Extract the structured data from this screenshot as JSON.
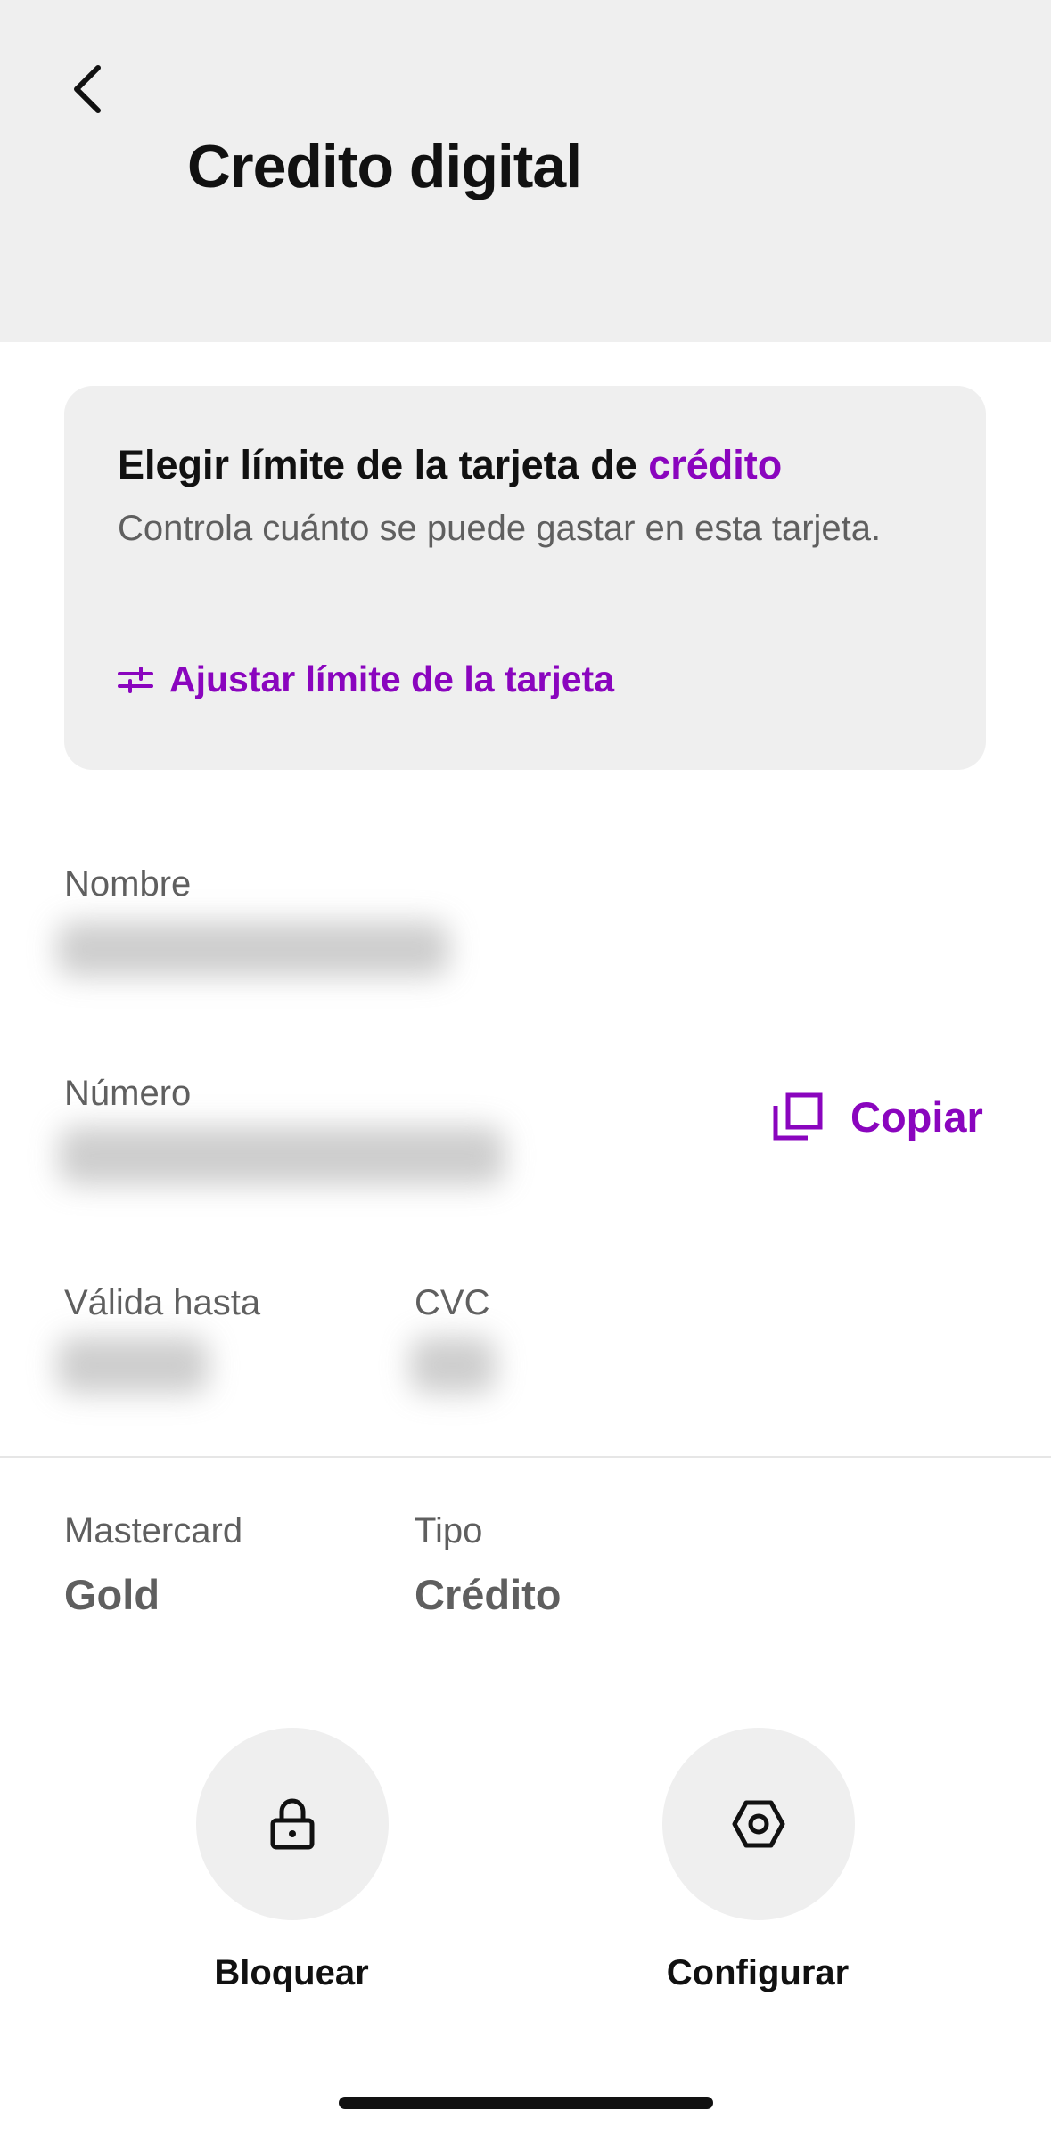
{
  "header": {
    "title": "Credito digital",
    "back_icon": "chevron-left-icon"
  },
  "limit_card": {
    "title_main": "Elegir límite de la tarjeta de ",
    "title_accent": "crédito",
    "description": "Controla cuánto se puede gastar en esta tarjeta.",
    "adjust_label": "Ajustar límite de la tarjeta",
    "adjust_icon": "sliders-icon"
  },
  "card_details": {
    "name_label": "Nombre",
    "number_label": "Número",
    "copy_label": "Copiar",
    "copy_icon": "copy-icon",
    "valid_label": "Válida hasta",
    "cvc_label": "CVC"
  },
  "card_meta": {
    "brand_label": "Mastercard",
    "brand_value": "Gold",
    "type_label": "Tipo",
    "type_value": "Crédito"
  },
  "actions": [
    {
      "label": "Bloquear",
      "icon": "lock-icon"
    },
    {
      "label": "Configurar",
      "icon": "settings-hexagon-icon"
    }
  ],
  "colors": {
    "accent": "#8a05be",
    "header_bg": "#efefef",
    "text_primary": "#111111",
    "text_secondary": "#5f5f5f"
  }
}
